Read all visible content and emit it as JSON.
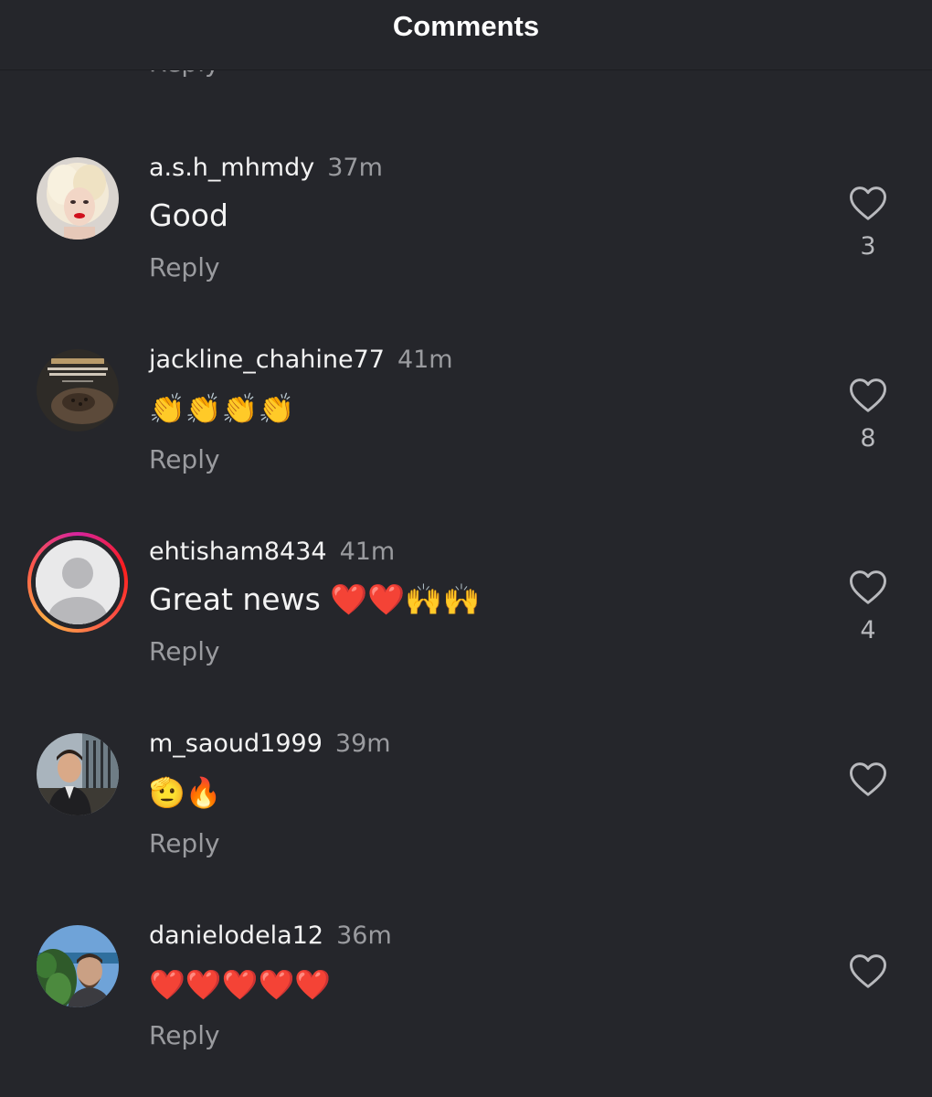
{
  "header": {
    "title": "Comments"
  },
  "cut_reply_label": "Reply",
  "comments": [
    {
      "username": "a.s.h_mhmdy",
      "time": "37m",
      "text": "Good",
      "reply_label": "Reply",
      "likes": "3"
    },
    {
      "username": "jackline_chahine77",
      "time": "41m",
      "text": "👏👏👏👏",
      "reply_label": "Reply",
      "likes": "8",
      "avatar_text": "WE BELONG TO ALLAH AND TO HIM WE WILL RETURN"
    },
    {
      "username": "ehtisham8434",
      "time": "41m",
      "text": "Great news ❤️❤️🙌🙌",
      "reply_label": "Reply",
      "likes": "4"
    },
    {
      "username": "m_saoud1999",
      "time": "39m",
      "text": "🫡🔥",
      "reply_label": "Reply",
      "likes": ""
    },
    {
      "username": "danielodela12",
      "time": "36m",
      "text": "❤️❤️❤️❤️❤️",
      "reply_label": "Reply",
      "likes": ""
    }
  ],
  "colors": {
    "background": "#25262b",
    "secondary_text": "#9a9b9f",
    "primary_text": "#f3f3f3",
    "story_ring": "#d6249f"
  },
  "icons": [
    "heart-outline-icon",
    "default-avatar-icon"
  ]
}
